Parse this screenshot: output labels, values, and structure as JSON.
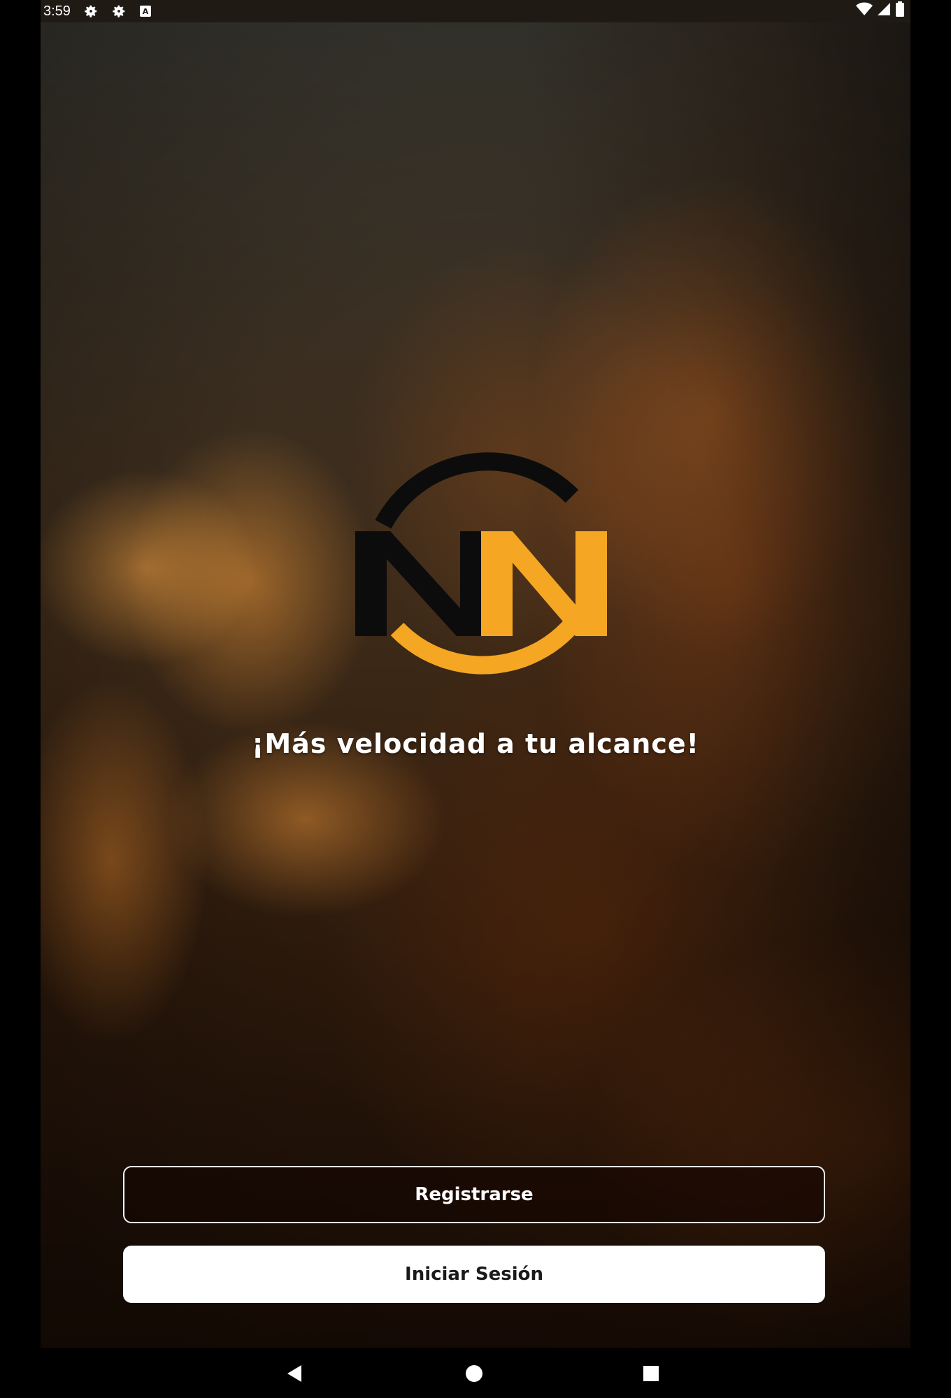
{
  "status_bar": {
    "time": "3:59",
    "left_icons": [
      "settings-icon",
      "settings-icon",
      "notification-icon"
    ],
    "right_icons": [
      "wifi-icon",
      "signal-icon",
      "battery-icon"
    ]
  },
  "logo": {
    "letters": "NN",
    "colors": {
      "dark": "#0c0c0c",
      "accent": "#f5a623"
    }
  },
  "tagline": "¡Más velocidad a tu alcance!",
  "buttons": {
    "register_label": "Registrarse",
    "login_label": "Iniciar Sesión"
  },
  "nav_bar": {
    "icons": [
      "back-icon",
      "home-icon",
      "recents-icon"
    ]
  }
}
